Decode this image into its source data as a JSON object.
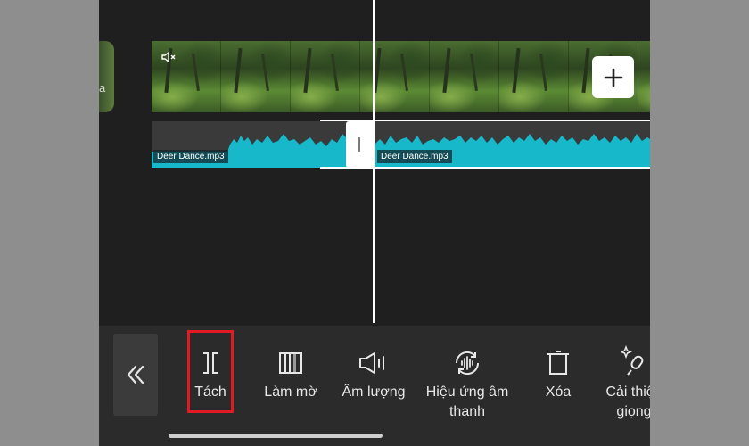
{
  "timeline": {
    "prev_clip_label": "a",
    "audio_clips": [
      {
        "label": "Deer Dance.mp3"
      },
      {
        "label": "Deer Dance.mp3"
      }
    ]
  },
  "icons": {
    "mute": "speaker-muted-icon",
    "add": "plus-icon",
    "collapse": "double-chevron-left-icon",
    "split": "split-icon",
    "blur": "blur-icon",
    "volume": "volume-icon",
    "soundfx": "sound-effect-icon",
    "delete": "trash-icon",
    "voice": "voice-enhance-icon"
  },
  "toolbar": {
    "items": [
      {
        "label": "Tách"
      },
      {
        "label": "Làm mờ"
      },
      {
        "label": "Âm lượng"
      },
      {
        "label": "Hiệu ứng âm thanh"
      },
      {
        "label": "Xóa"
      },
      {
        "label": "Cải thiện giọng"
      }
    ]
  },
  "colors": {
    "audio_wave": "#16b8c9",
    "highlight": "#e01b24",
    "background": "#1f1f1f",
    "toolbar": "#2b2b2b"
  }
}
